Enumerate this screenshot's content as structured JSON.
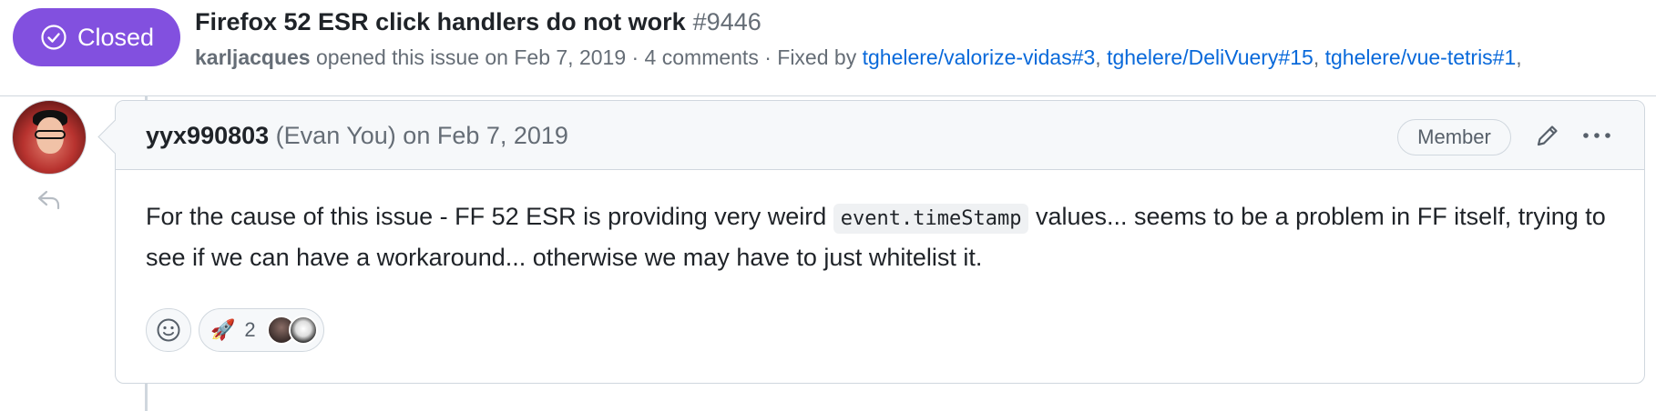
{
  "issue": {
    "state_label": "Closed",
    "title": "Firefox 52 ESR click handlers do not work",
    "number": "#9446",
    "author": "karljacques",
    "opened_text": "opened this issue on Feb 7, 2019 · 4 comments · Fixed by",
    "fixed_by": [
      "tghelere/valorize-vidas#3",
      "tghelere/DeliVuery#15",
      "tghelere/vue-tetris#1"
    ],
    "accent_color": "#8250df"
  },
  "comment": {
    "login": "yyx990803",
    "name": "(Evan You)",
    "date": "on Feb 7, 2019",
    "role_badge": "Member",
    "body_before": "For the cause of this issue - FF 52 ESR is providing very weird ",
    "body_code": "event.timeStamp",
    "body_after": " values... seems to be a problem in FF itself, trying to see if we can have a workaround... otherwise we may have to just whitelist it.",
    "reactions": [
      {
        "emoji": "🚀",
        "count": "2"
      }
    ]
  },
  "icons": {
    "state": "issue-closed-icon",
    "reply": "reply-icon",
    "edit": "pencil-icon",
    "more": "kebab-horizontal-icon",
    "add_reaction": "smiley-icon"
  }
}
